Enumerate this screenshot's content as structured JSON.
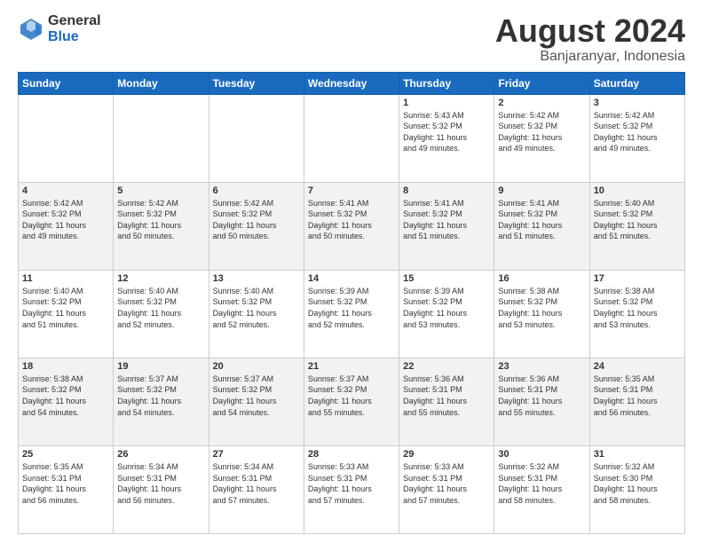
{
  "logo": {
    "general": "General",
    "blue": "Blue"
  },
  "title": "August 2024",
  "subtitle": "Banjaranyar, Indonesia",
  "days_header": [
    "Sunday",
    "Monday",
    "Tuesday",
    "Wednesday",
    "Thursday",
    "Friday",
    "Saturday"
  ],
  "weeks": [
    [
      {
        "day": "",
        "info": ""
      },
      {
        "day": "",
        "info": ""
      },
      {
        "day": "",
        "info": ""
      },
      {
        "day": "",
        "info": ""
      },
      {
        "day": "1",
        "info": "Sunrise: 5:43 AM\nSunset: 5:32 PM\nDaylight: 11 hours\nand 49 minutes."
      },
      {
        "day": "2",
        "info": "Sunrise: 5:42 AM\nSunset: 5:32 PM\nDaylight: 11 hours\nand 49 minutes."
      },
      {
        "day": "3",
        "info": "Sunrise: 5:42 AM\nSunset: 5:32 PM\nDaylight: 11 hours\nand 49 minutes."
      }
    ],
    [
      {
        "day": "4",
        "info": "Sunrise: 5:42 AM\nSunset: 5:32 PM\nDaylight: 11 hours\nand 49 minutes."
      },
      {
        "day": "5",
        "info": "Sunrise: 5:42 AM\nSunset: 5:32 PM\nDaylight: 11 hours\nand 50 minutes."
      },
      {
        "day": "6",
        "info": "Sunrise: 5:42 AM\nSunset: 5:32 PM\nDaylight: 11 hours\nand 50 minutes."
      },
      {
        "day": "7",
        "info": "Sunrise: 5:41 AM\nSunset: 5:32 PM\nDaylight: 11 hours\nand 50 minutes."
      },
      {
        "day": "8",
        "info": "Sunrise: 5:41 AM\nSunset: 5:32 PM\nDaylight: 11 hours\nand 51 minutes."
      },
      {
        "day": "9",
        "info": "Sunrise: 5:41 AM\nSunset: 5:32 PM\nDaylight: 11 hours\nand 51 minutes."
      },
      {
        "day": "10",
        "info": "Sunrise: 5:40 AM\nSunset: 5:32 PM\nDaylight: 11 hours\nand 51 minutes."
      }
    ],
    [
      {
        "day": "11",
        "info": "Sunrise: 5:40 AM\nSunset: 5:32 PM\nDaylight: 11 hours\nand 51 minutes."
      },
      {
        "day": "12",
        "info": "Sunrise: 5:40 AM\nSunset: 5:32 PM\nDaylight: 11 hours\nand 52 minutes."
      },
      {
        "day": "13",
        "info": "Sunrise: 5:40 AM\nSunset: 5:32 PM\nDaylight: 11 hours\nand 52 minutes."
      },
      {
        "day": "14",
        "info": "Sunrise: 5:39 AM\nSunset: 5:32 PM\nDaylight: 11 hours\nand 52 minutes."
      },
      {
        "day": "15",
        "info": "Sunrise: 5:39 AM\nSunset: 5:32 PM\nDaylight: 11 hours\nand 53 minutes."
      },
      {
        "day": "16",
        "info": "Sunrise: 5:38 AM\nSunset: 5:32 PM\nDaylight: 11 hours\nand 53 minutes."
      },
      {
        "day": "17",
        "info": "Sunrise: 5:38 AM\nSunset: 5:32 PM\nDaylight: 11 hours\nand 53 minutes."
      }
    ],
    [
      {
        "day": "18",
        "info": "Sunrise: 5:38 AM\nSunset: 5:32 PM\nDaylight: 11 hours\nand 54 minutes."
      },
      {
        "day": "19",
        "info": "Sunrise: 5:37 AM\nSunset: 5:32 PM\nDaylight: 11 hours\nand 54 minutes."
      },
      {
        "day": "20",
        "info": "Sunrise: 5:37 AM\nSunset: 5:32 PM\nDaylight: 11 hours\nand 54 minutes."
      },
      {
        "day": "21",
        "info": "Sunrise: 5:37 AM\nSunset: 5:32 PM\nDaylight: 11 hours\nand 55 minutes."
      },
      {
        "day": "22",
        "info": "Sunrise: 5:36 AM\nSunset: 5:31 PM\nDaylight: 11 hours\nand 55 minutes."
      },
      {
        "day": "23",
        "info": "Sunrise: 5:36 AM\nSunset: 5:31 PM\nDaylight: 11 hours\nand 55 minutes."
      },
      {
        "day": "24",
        "info": "Sunrise: 5:35 AM\nSunset: 5:31 PM\nDaylight: 11 hours\nand 56 minutes."
      }
    ],
    [
      {
        "day": "25",
        "info": "Sunrise: 5:35 AM\nSunset: 5:31 PM\nDaylight: 11 hours\nand 56 minutes."
      },
      {
        "day": "26",
        "info": "Sunrise: 5:34 AM\nSunset: 5:31 PM\nDaylight: 11 hours\nand 56 minutes."
      },
      {
        "day": "27",
        "info": "Sunrise: 5:34 AM\nSunset: 5:31 PM\nDaylight: 11 hours\nand 57 minutes."
      },
      {
        "day": "28",
        "info": "Sunrise: 5:33 AM\nSunset: 5:31 PM\nDaylight: 11 hours\nand 57 minutes."
      },
      {
        "day": "29",
        "info": "Sunrise: 5:33 AM\nSunset: 5:31 PM\nDaylight: 11 hours\nand 57 minutes."
      },
      {
        "day": "30",
        "info": "Sunrise: 5:32 AM\nSunset: 5:31 PM\nDaylight: 11 hours\nand 58 minutes."
      },
      {
        "day": "31",
        "info": "Sunrise: 5:32 AM\nSunset: 5:30 PM\nDaylight: 11 hours\nand 58 minutes."
      }
    ]
  ]
}
